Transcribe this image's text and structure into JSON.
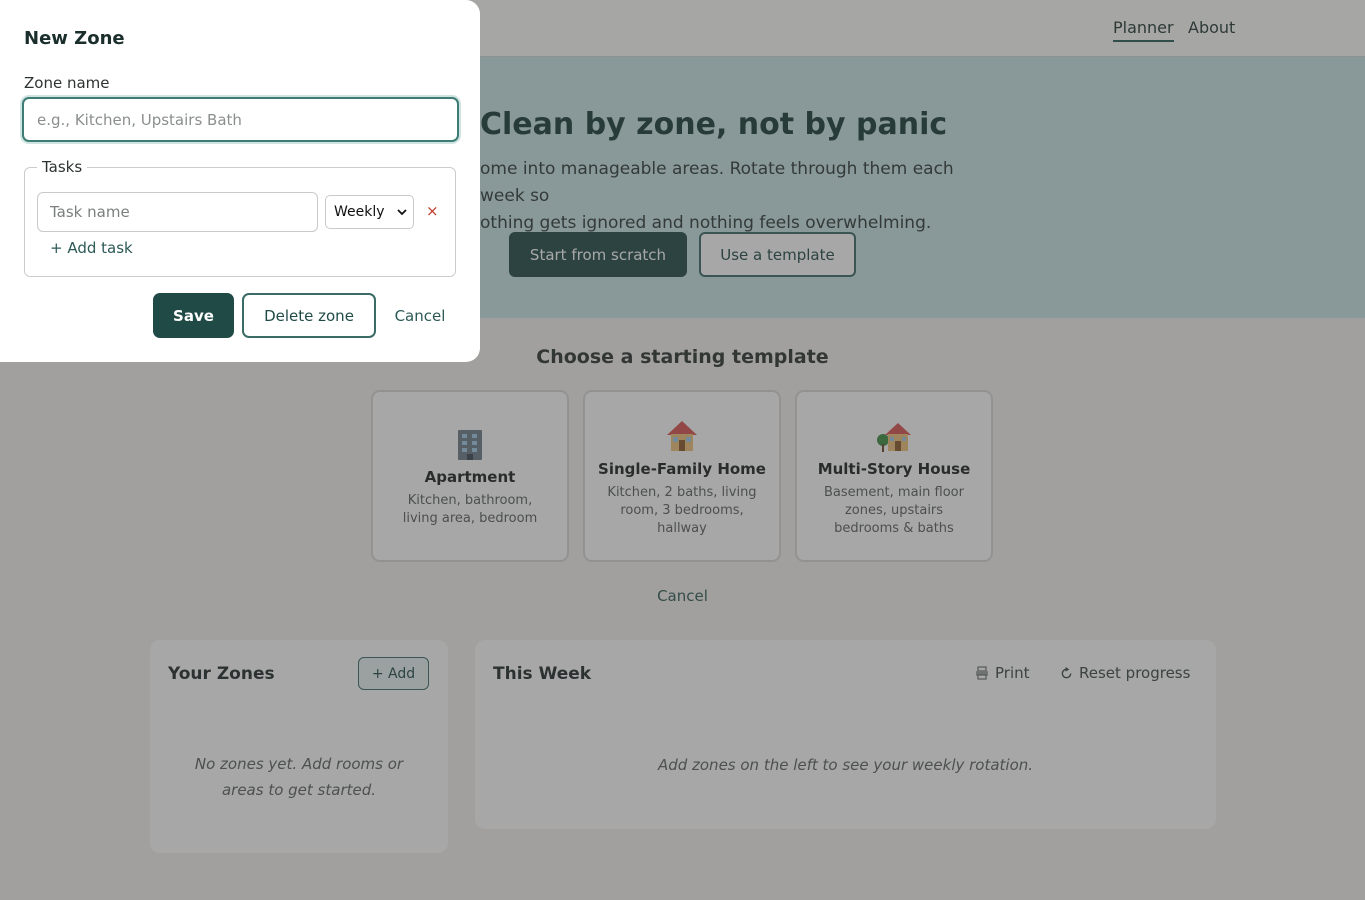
{
  "nav": {
    "links": [
      {
        "label": "Planner",
        "active": true
      },
      {
        "label": "About",
        "active": false
      }
    ]
  },
  "hero": {
    "title": "Clean by zone, not by panic",
    "text_line1": "ome into manageable areas. Rotate through them each week so",
    "text_line2": "othing gets ignored and nothing feels overwhelming.",
    "primary_button": "Start from scratch",
    "secondary_button": "Use a template"
  },
  "templates": {
    "heading": "Choose a starting template",
    "cards": [
      {
        "icon": "🏢",
        "icon_name": "office-building-icon",
        "name": "Apartment",
        "desc": "Kitchen, bathroom, living area, bedroom"
      },
      {
        "icon": "🏠",
        "icon_name": "house-icon",
        "name": "Single-Family Home",
        "desc": "Kitchen, 2 baths, living room, 3 bedrooms, hallway"
      },
      {
        "icon": "🏡",
        "icon_name": "house-with-garden-icon",
        "name": "Multi-Story House",
        "desc": "Basement, main floor zones, upstairs bedrooms & baths"
      }
    ],
    "cancel": "Cancel"
  },
  "zones_panel": {
    "title": "Your Zones",
    "add_button": "+ Add",
    "empty_line1": "No zones yet. Add rooms or",
    "empty_line2": "areas to get started."
  },
  "week_panel": {
    "title": "This Week",
    "print_label": "Print",
    "reset_label": "Reset progress",
    "empty_text": "Add zones on the left to see your weekly rotation."
  },
  "modal": {
    "title": "New Zone",
    "zone_name_label": "Zone name",
    "zone_name_placeholder": "e.g., Kitchen, Upstairs Bath",
    "zone_name_value": "",
    "tasks_legend": "Tasks",
    "task_placeholder": "Task name",
    "frequency_selected": "Weekly",
    "remove_symbol": "×",
    "add_task": "+ Add task",
    "save": "Save",
    "delete": "Delete zone",
    "cancel": "Cancel"
  },
  "colors": {
    "primary": "#1f4a46",
    "hero_bg": "#c9e3e3",
    "danger": "#c0392b"
  }
}
